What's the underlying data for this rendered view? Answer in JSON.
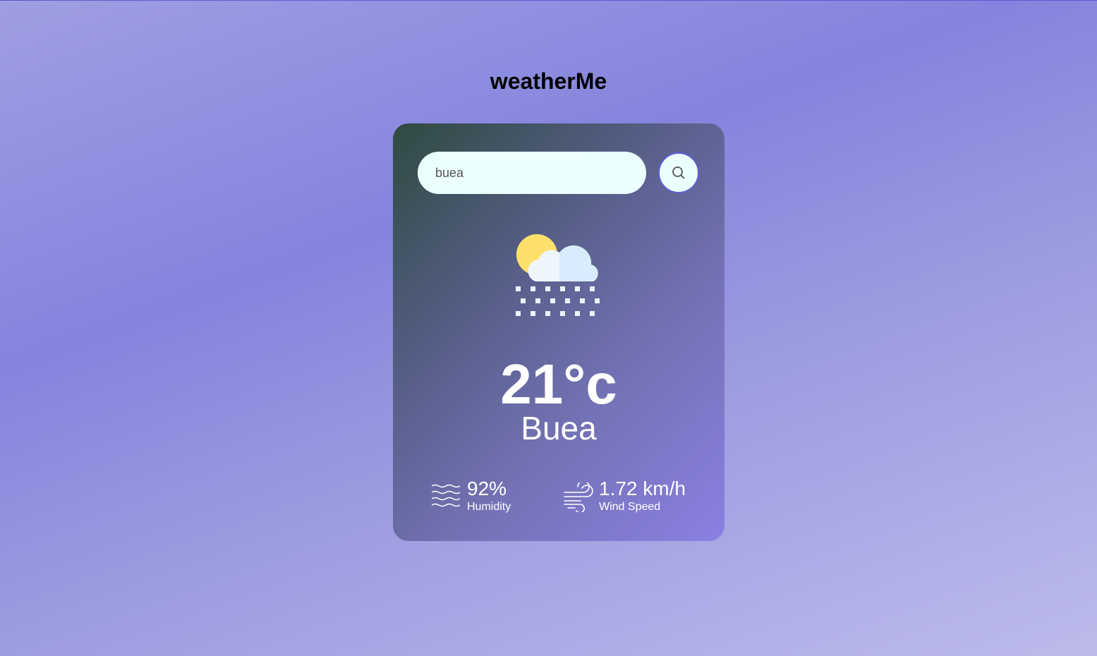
{
  "app": {
    "title": "weatherMe"
  },
  "search": {
    "value": "buea",
    "placeholder": "",
    "button_icon": "search-icon"
  },
  "weather": {
    "icon": "snow-sun-cloud-icon",
    "temperature": "21°c",
    "city": "Buea"
  },
  "stats": {
    "humidity": {
      "icon": "humidity-icon",
      "value": "92%",
      "label": "Humidity"
    },
    "wind": {
      "icon": "wind-icon",
      "value": "1.72 km/h",
      "label": "Wind Speed"
    }
  },
  "colors": {
    "accent": "#5f5fd3",
    "input_bg": "#ebfffc",
    "sun": "#ffe06b",
    "cloud": "#dbeeff"
  }
}
